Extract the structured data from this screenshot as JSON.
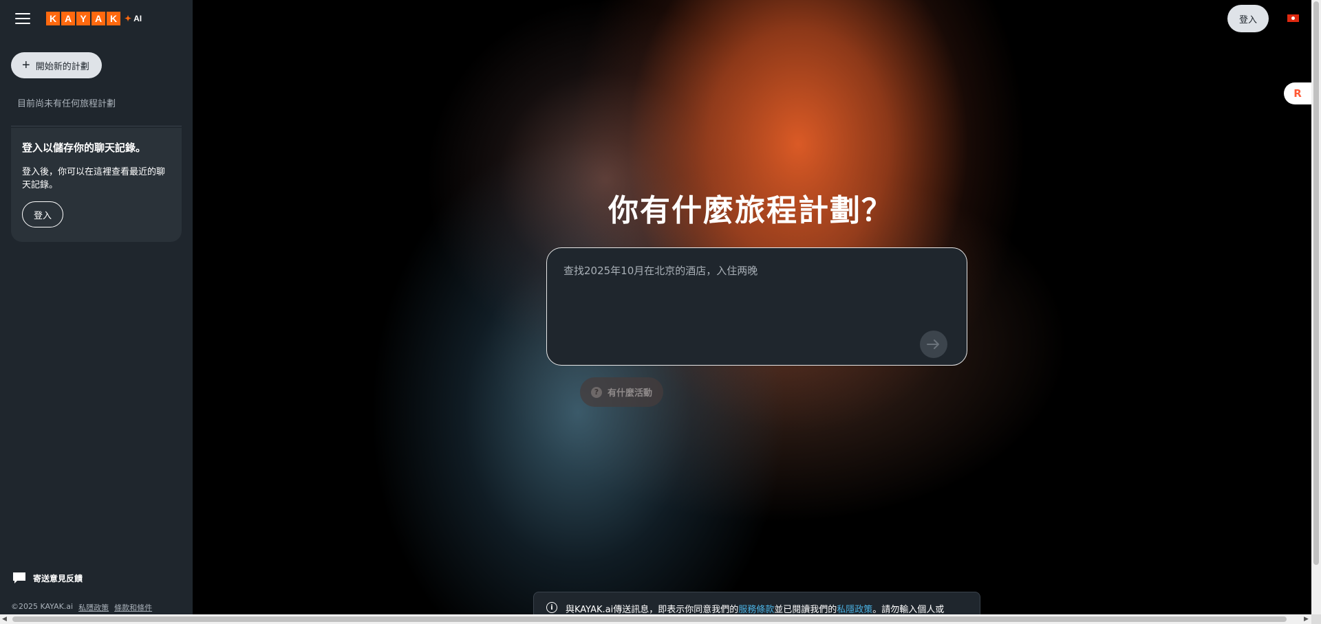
{
  "sidebar": {
    "logo_letters": [
      "K",
      "A",
      "Y",
      "A",
      "K"
    ],
    "logo_ai": "AI",
    "new_plan_label": "開始新的計劃",
    "no_plans_text": "目前尚未有任何旅程計劃",
    "login_card": {
      "title": "登入以儲存你的聊天記錄。",
      "description": "登入後，你可以在這裡查看最近的聊天記錄。",
      "button_label": "登入"
    },
    "feedback_label": "寄送意見反饋",
    "footer": {
      "copyright": "©2025 KAYAK.ai",
      "privacy_label": "私隱政策",
      "terms_label": "條款和條件"
    }
  },
  "header": {
    "login_label": "登入",
    "flag": "hong-kong-flag-icon"
  },
  "main": {
    "headline": "你有什麼旅程計劃？",
    "prompt_placeholder": "查找2025年10月在北京的酒店，入住两晚",
    "activity_chip_label": "有什麼活動",
    "notice": {
      "prefix": "與KAYAK.ai傳送訊息，即表示你同意我們的",
      "terms_link": "服務條款",
      "middle": "並已閱讀我們的",
      "privacy_link": "私隱政策",
      "suffix": "。請勿輸入個人或"
    }
  },
  "colors": {
    "brand_orange": "#ff690f",
    "sidebar_bg": "#1f262d",
    "link_blue": "#4ab0e0"
  }
}
